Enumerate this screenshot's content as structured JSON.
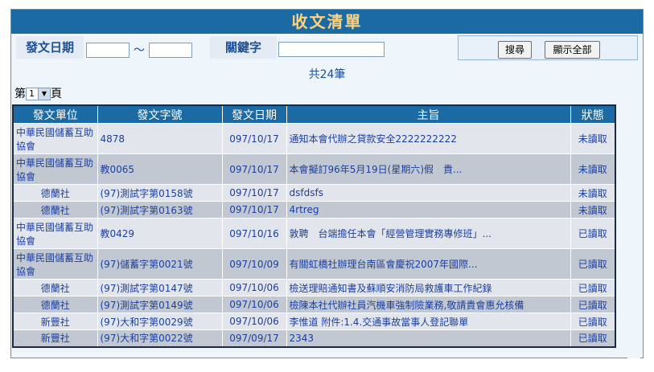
{
  "page": {
    "title": "收文清單"
  },
  "search": {
    "date_label": "發文日期",
    "date_from": "",
    "tilde": "～",
    "date_to": "",
    "keyword_label": "關鍵字",
    "keyword": "",
    "search_button": "搜尋",
    "show_all_button": "顯示全部"
  },
  "summary": {
    "count_text": "共24筆"
  },
  "pager": {
    "prefix": "第",
    "page": "1",
    "suffix": "頁"
  },
  "table": {
    "headers": [
      "發文單位",
      "發文字號",
      "發文日期",
      "主旨",
      "狀態"
    ],
    "rows": [
      {
        "unit": "中華民國儲蓄互助協會",
        "doc_no": "4878",
        "date": "097/10/17",
        "subject": "通知本會代辦之貸款安全2222222222",
        "status": "未讀取",
        "read": false,
        "tall": true
      },
      {
        "unit": "中華民國儲蓄互助協會",
        "doc_no": "教0065",
        "date": "097/10/17",
        "subject": "本會擬訂96年5月19日(星期六)假　貴...",
        "status": "未讀取",
        "read": false,
        "tall": true
      },
      {
        "unit": "德蘭社",
        "doc_no": "(97)測試字第0158號",
        "date": "097/10/17",
        "subject": "dsfdsfs",
        "status": "未讀取",
        "read": false,
        "tall": false
      },
      {
        "unit": "德蘭社",
        "doc_no": "(97)測試字第0163號",
        "date": "097/10/17",
        "subject": "4rtreg",
        "status": "未讀取",
        "read": false,
        "tall": false
      },
      {
        "unit": "中華民國儲蓄互助協會",
        "doc_no": "教0429",
        "date": "097/10/16",
        "subject": "敦聘　台端擔任本會「經營管理實務專修班」...",
        "status": "已讀取",
        "read": true,
        "tall": true
      },
      {
        "unit": "中華民國儲蓄互助協會",
        "doc_no": "(97)儲蓄字第0021號",
        "date": "097/10/09",
        "subject": "有關虹橋社辦理台南區會慶祝2007年國際...",
        "status": "已讀取",
        "read": true,
        "tall": true
      },
      {
        "unit": "德蘭社",
        "doc_no": "(97)測試字第0147號",
        "date": "097/10/06",
        "subject": "檢送理賠通知書及蘇順安消防局救護車工作紀錄",
        "status": "已讀取",
        "read": true,
        "tall": false
      },
      {
        "unit": "德蘭社",
        "doc_no": "(97)測試字第0149號",
        "date": "097/10/06",
        "subject": "檢陳本社代辦社員汽機車強制險業務,敬請貴會惠允核備",
        "status": "已讀取",
        "read": true,
        "tall": false
      },
      {
        "unit": "新豐社",
        "doc_no": "(97)大和字第0029號",
        "date": "097/10/06",
        "subject": "李惟道 附件:1.4.交通事故當事人登記聯單",
        "status": "已讀取",
        "read": true,
        "tall": false
      },
      {
        "unit": "新豐社",
        "doc_no": "(97)大和字第0022號",
        "date": "097/09/17",
        "subject": "2343",
        "status": "已讀取",
        "read": true,
        "tall": false
      }
    ]
  }
}
